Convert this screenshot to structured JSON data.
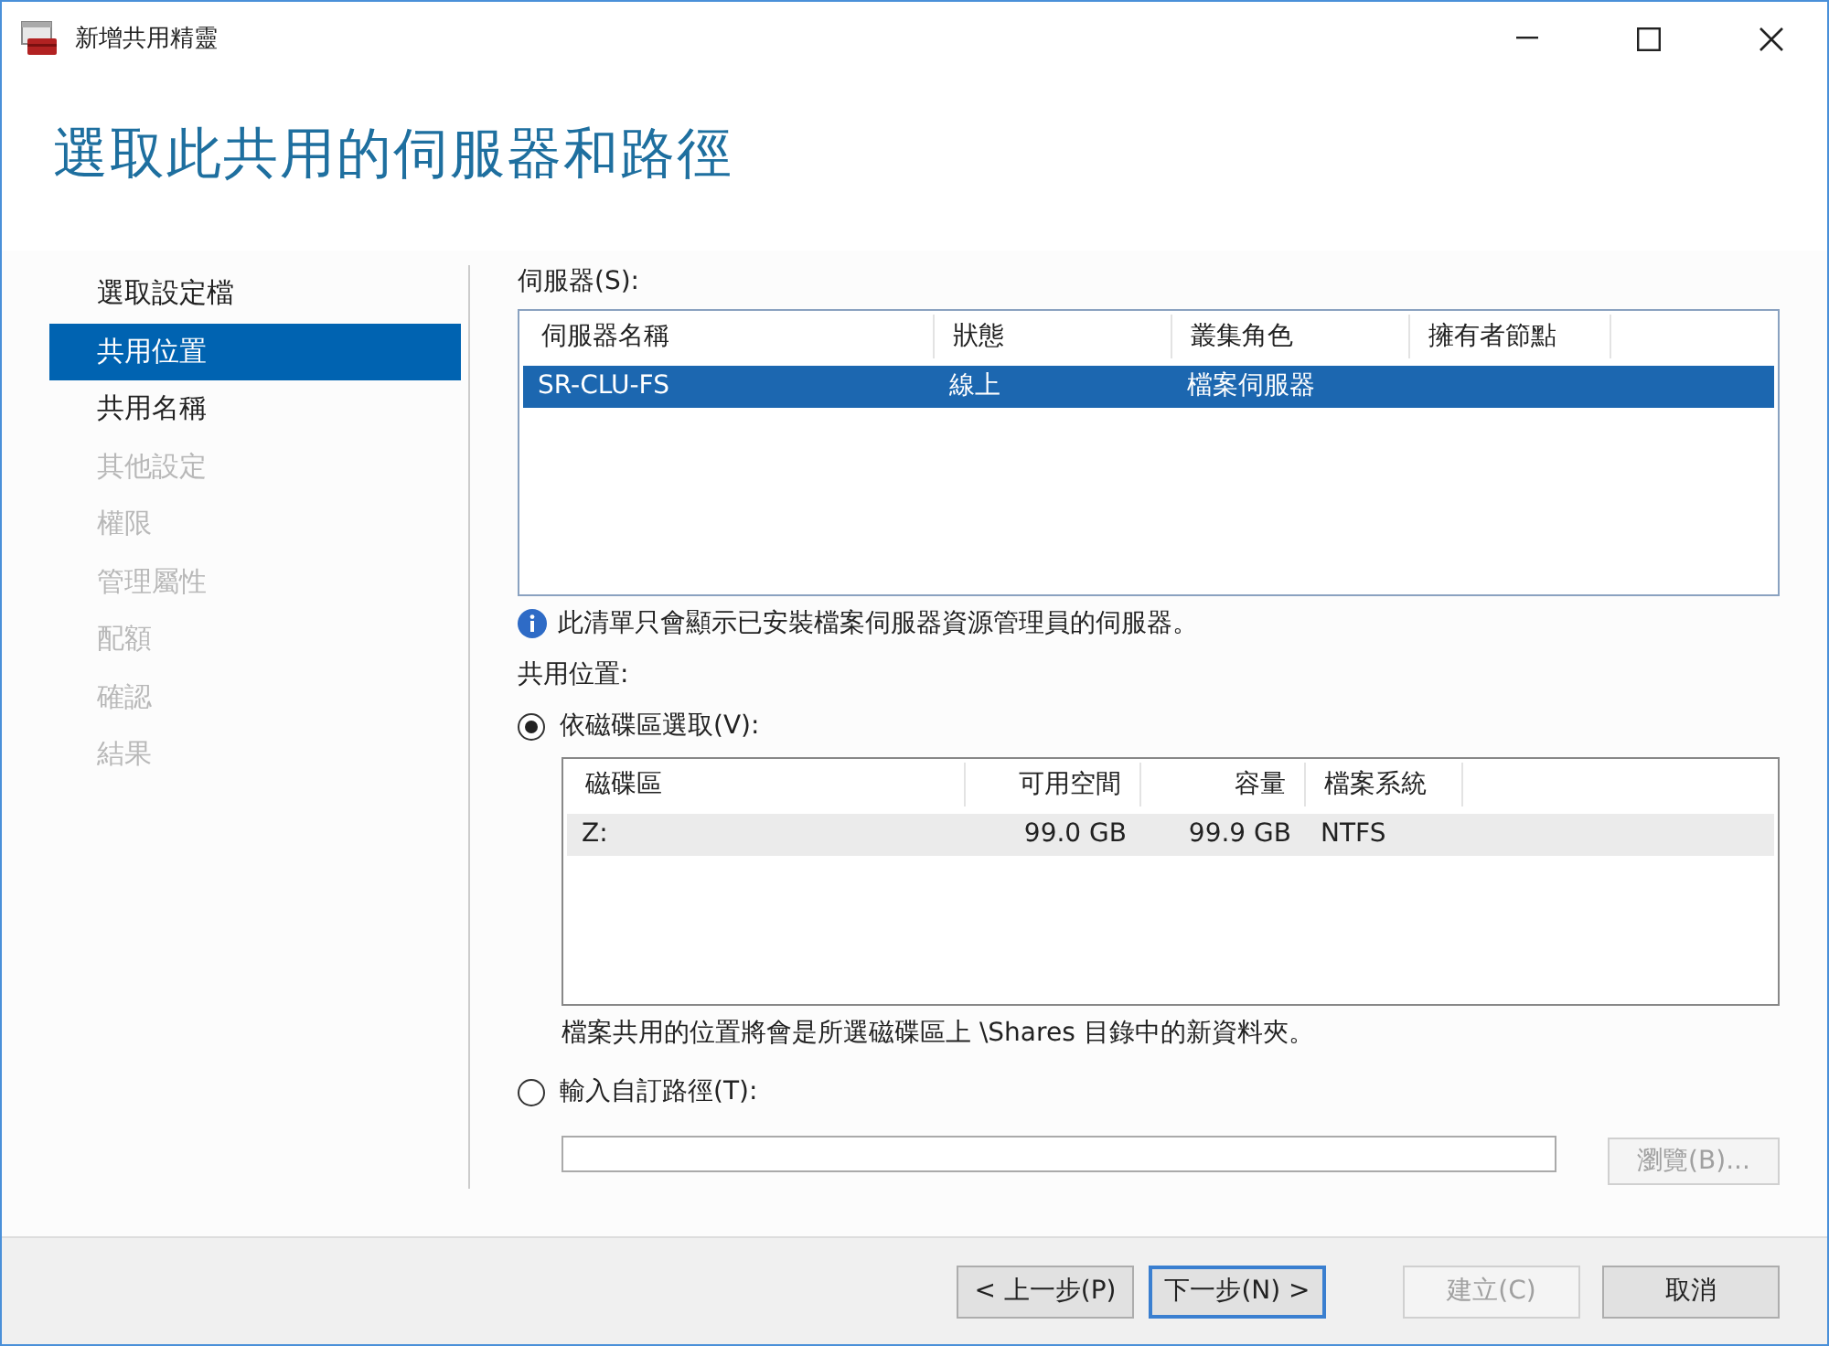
{
  "window": {
    "title": "新增共用精靈"
  },
  "heading": "選取此共用的伺服器和路徑",
  "steps": [
    {
      "label": "選取設定檔",
      "selected": false,
      "disabled": false
    },
    {
      "label": "共用位置",
      "selected": true,
      "disabled": false
    },
    {
      "label": "共用名稱",
      "selected": false,
      "disabled": false
    },
    {
      "label": "其他設定",
      "selected": false,
      "disabled": true
    },
    {
      "label": "權限",
      "selected": false,
      "disabled": true
    },
    {
      "label": "管理屬性",
      "selected": false,
      "disabled": true
    },
    {
      "label": "配額",
      "selected": false,
      "disabled": true
    },
    {
      "label": "確認",
      "selected": false,
      "disabled": true
    },
    {
      "label": "結果",
      "selected": false,
      "disabled": true
    }
  ],
  "servers": {
    "label": "伺服器(S):",
    "columns": [
      "伺服器名稱",
      "狀態",
      "叢集角色",
      "擁有者節點"
    ],
    "rows": [
      {
        "cells": [
          "SR-CLU-FS",
          "線上",
          "檔案伺服器",
          ""
        ],
        "selected": true
      }
    ],
    "note": "此清單只會顯示已安裝檔案伺服器資源管理員的伺服器。"
  },
  "share_location": {
    "label": "共用位置:",
    "by_volume": {
      "label": "依磁碟區選取(V):",
      "selected": true,
      "columns": [
        "磁碟區",
        "可用空間",
        "容量",
        "檔案系統"
      ],
      "rows": [
        {
          "cells": [
            "Z:",
            "99.0 GB",
            "99.9 GB",
            "NTFS"
          ],
          "selected": true
        }
      ],
      "note": "檔案共用的位置將會是所選磁碟區上 \\Shares 目錄中的新資料夾。"
    },
    "custom_path": {
      "label": "輸入自訂路徑(T):",
      "selected": false,
      "browse": {
        "label": "瀏覽(B)...",
        "disabled": true
      }
    }
  },
  "buttons": [
    {
      "label": "< 上一步(P)",
      "disabled": false,
      "default": false
    },
    {
      "label": "下一步(N) >",
      "disabled": false,
      "default": true
    },
    {
      "label": "建立(C)",
      "disabled": true,
      "default": false
    },
    {
      "label": "取消",
      "disabled": false,
      "default": false
    }
  ]
}
